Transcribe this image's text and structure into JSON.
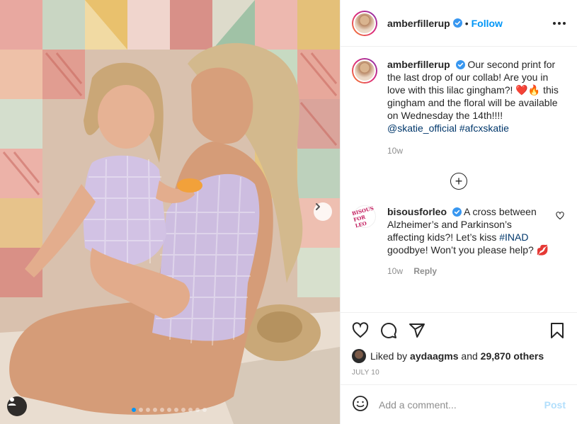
{
  "post": {
    "username": "amberfillerup",
    "follow_label": "Follow",
    "separator": "•",
    "caption_text": "Our second print for the last drop of our collab! Are you in love with this lilac gingham?! ❤️🔥 this gingham and the floral will be available on Wednesday the 14th!!!!",
    "mention": "@skatie_official",
    "hashtag": "#afcxskatie",
    "caption_time": "10w",
    "load_more_symbol": "+",
    "likes_text": "Liked by",
    "likes_user": "aydaagms",
    "likes_and": "and",
    "likes_count": "29,870 others",
    "date": "JULY 10",
    "comment_placeholder": "Add a comment...",
    "post_label": "Post"
  },
  "comment": {
    "username": "bisousforleo",
    "avatar_text": "BISOUS FOR LEO",
    "text_before": "A cross between Alzheimer’s and Parkinson’s affecting kids?! Let’s kiss",
    "hashtag": "#INAD",
    "text_after": "goodbye! Won’t you please help? 💋",
    "time": "10w",
    "reply_label": "Reply"
  },
  "carousel": {
    "slides": 11,
    "active_index": 0
  },
  "colors": {
    "accent": "#0095f6",
    "text": "#262626",
    "muted": "#8e8e8e",
    "link": "#00376b"
  },
  "icons": [
    "more-icon",
    "verified-icon",
    "heart-icon",
    "comment-icon",
    "share-icon",
    "bookmark-icon",
    "emoji-icon",
    "next-arrow-icon",
    "user-tag-icon",
    "plus-circle-icon"
  ]
}
